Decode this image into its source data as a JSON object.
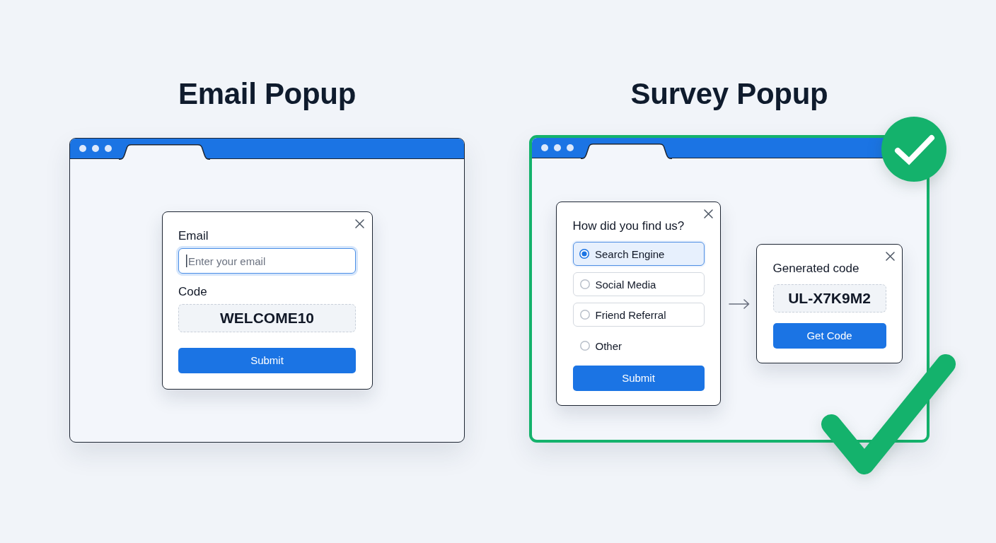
{
  "panels": [
    {
      "title": "Email Popup",
      "approved": false,
      "popups": [
        {
          "kind": "signup",
          "items": [
            {
              "kind": "label",
              "text": "Email"
            },
            {
              "kind": "input",
              "placeholder": "Enter your email",
              "focused": true
            },
            {
              "kind": "label",
              "text": "Code"
            },
            {
              "kind": "code",
              "text": "WELCOME10"
            },
            {
              "kind": "button",
              "text": "Submit"
            }
          ]
        }
      ]
    },
    {
      "title": "Survey Popup",
      "approved": true,
      "popups": [
        {
          "kind": "survey",
          "items": [
            {
              "kind": "heading",
              "text": "How did you find us?"
            },
            {
              "kind": "options",
              "options": [
                {
                  "kind": "card",
                  "label": "Search Engine",
                  "selected": true
                },
                {
                  "kind": "card",
                  "label": "Social Media",
                  "selected": false
                },
                {
                  "kind": "card",
                  "label": "Friend Referral",
                  "selected": false
                },
                {
                  "kind": "plain",
                  "label": "Other",
                  "selected": false
                }
              ]
            },
            {
              "kind": "button",
              "text": "Submit"
            }
          ]
        },
        {
          "kind": "code_reveal",
          "items": [
            {
              "kind": "heading",
              "text": "Generated code"
            },
            {
              "kind": "code",
              "text": "UL-X7K9M2"
            },
            {
              "kind": "button",
              "text": "Get Code"
            }
          ]
        }
      ]
    }
  ]
}
